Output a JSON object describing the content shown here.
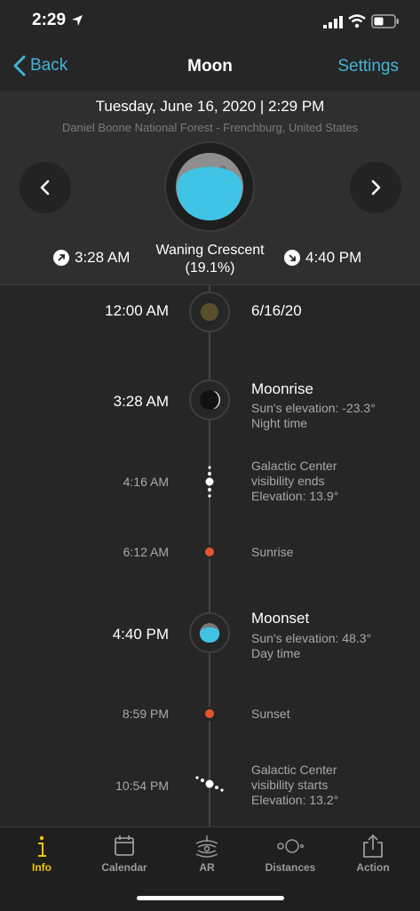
{
  "status_bar": {
    "time": "2:29"
  },
  "nav": {
    "back_label": "Back",
    "title": "Moon",
    "settings_label": "Settings"
  },
  "header": {
    "datetime": "Tuesday, June 16, 2020 | 2:29 PM",
    "location": "Daniel Boone National Forest - Frenchburg, United States",
    "moonrise": "3:28 AM",
    "moonset": "4:40 PM",
    "phase_name": "Waning Crescent",
    "phase_pct": "(19.1%)"
  },
  "timeline": [
    {
      "time": "12:00 AM",
      "title": "6/16/20"
    },
    {
      "time": "3:28 AM",
      "title": "Moonrise",
      "line1": "Sun's elevation: -23.3°",
      "line2": "Night time"
    },
    {
      "time": "4:16 AM",
      "title": "Galactic Center",
      "line1": "visibility ends",
      "line2": "Elevation: 13.9°"
    },
    {
      "time": "6:12 AM",
      "title": "Sunrise"
    },
    {
      "time": "4:40 PM",
      "title": "Moonset",
      "line1": "Sun's elevation: 48.3°",
      "line2": "Day time"
    },
    {
      "time": "8:59 PM",
      "title": "Sunset"
    },
    {
      "time": "10:54 PM",
      "title": "Galactic Center",
      "line1": "visibility starts",
      "line2": "Elevation: 13.2°"
    }
  ],
  "tabs": [
    {
      "label": "Info"
    },
    {
      "label": "Calendar"
    },
    {
      "label": "AR"
    },
    {
      "label": "Distances"
    },
    {
      "label": "Action"
    }
  ],
  "colors": {
    "accent": "#42b4d6",
    "active_tab": "#f0c800",
    "sun_dot": "#e8542a",
    "moon_lit": "#3fc4e6"
  }
}
